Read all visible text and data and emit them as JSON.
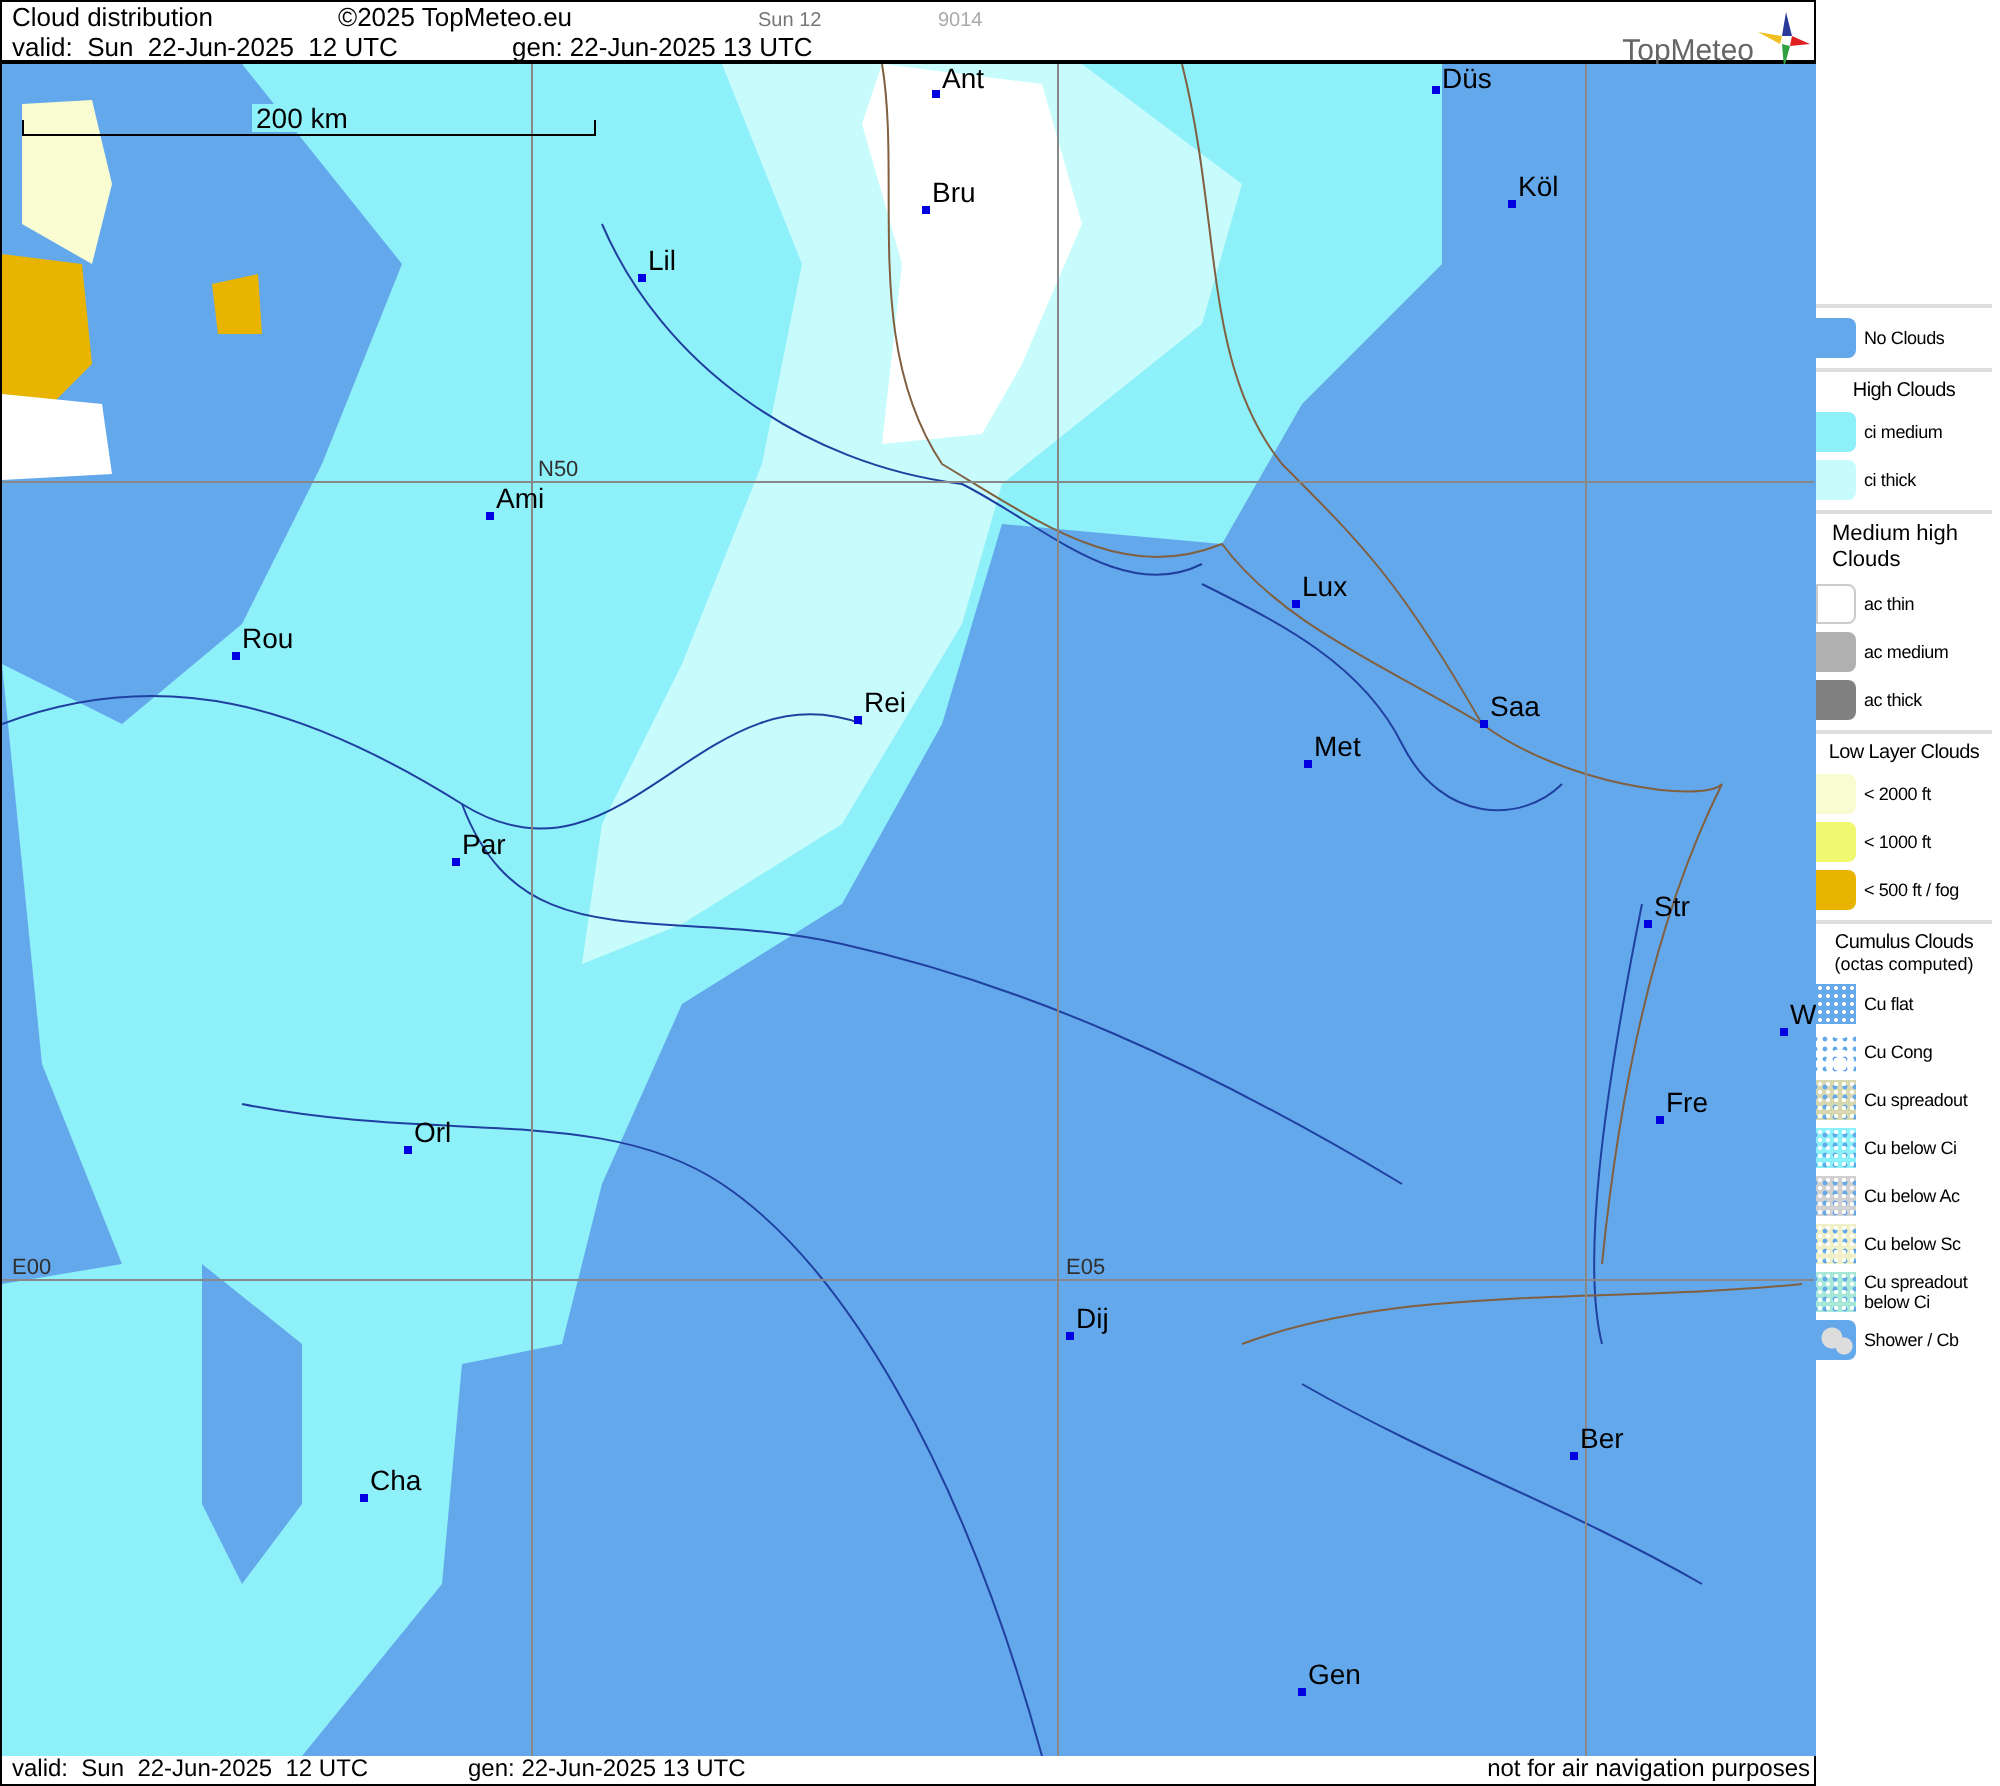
{
  "header": {
    "title": "Cloud distribution",
    "copyright": "©2025 TopMeteo.eu",
    "run": "Sun 12",
    "code": "9014",
    "valid": "valid:  Sun  22-Jun-2025  12 UTC",
    "generated": "gen: 22-Jun-2025 13 UTC",
    "logo": "TopMeteo"
  },
  "map": {
    "scale": "200 km",
    "grid_labels": [
      "N50",
      "E00",
      "E05"
    ],
    "cities": [
      {
        "name": "Ant"
      },
      {
        "name": "Düs"
      },
      {
        "name": "Bru"
      },
      {
        "name": "Köl"
      },
      {
        "name": "Lil"
      },
      {
        "name": "Ami"
      },
      {
        "name": "Lux"
      },
      {
        "name": "Rou"
      },
      {
        "name": "Rei"
      },
      {
        "name": "Saa"
      },
      {
        "name": "Met"
      },
      {
        "name": "Par"
      },
      {
        "name": "Str"
      },
      {
        "name": "W"
      },
      {
        "name": "Fre"
      },
      {
        "name": "Orl"
      },
      {
        "name": "Dij"
      },
      {
        "name": "Ber"
      },
      {
        "name": "Cha"
      },
      {
        "name": "Gen"
      }
    ]
  },
  "legend": {
    "sections": [
      {
        "items": [
          {
            "label": "No Clouds",
            "kind": "solid",
            "color": "#64a8ec"
          }
        ]
      },
      {
        "title": "High Clouds",
        "items": [
          {
            "label": "ci medium",
            "kind": "solid",
            "color": "#8ef0f8"
          },
          {
            "label": "ci thick",
            "kind": "solid",
            "color": "#c8fcfc"
          }
        ]
      },
      {
        "title": "Medium high Clouds",
        "items": [
          {
            "label": "ac thin",
            "kind": "solid",
            "color": "#ffffff"
          },
          {
            "label": "ac medium",
            "kind": "solid",
            "color": "#b0b0b0"
          },
          {
            "label": "ac thick",
            "kind": "solid",
            "color": "#808080"
          }
        ]
      },
      {
        "title": "Low Layer Clouds",
        "items": [
          {
            "label": "< 2000 ft",
            "kind": "solid",
            "color": "#f8fcd0"
          },
          {
            "label": "< 1000 ft",
            "kind": "solid",
            "color": "#f0f870"
          },
          {
            "label": "< 500 ft / fog",
            "kind": "solid",
            "color": "#e8b400"
          }
        ]
      },
      {
        "title": "Cumulus Clouds",
        "subtitle": "(octas computed)",
        "items": [
          {
            "label": "Cu flat",
            "kind": "speckled",
            "color": "#64a8ec"
          },
          {
            "label": "Cu Cong",
            "kind": "speckled",
            "color": "#ffffff"
          },
          {
            "label": "Cu spreadout",
            "kind": "speckled",
            "color": "#d8d8b0"
          },
          {
            "label": "Cu below Ci",
            "kind": "speckled",
            "color": "#8ef0f8"
          },
          {
            "label": "Cu below Ac",
            "kind": "speckled",
            "color": "#d0d0d0"
          },
          {
            "label": "Cu below Sc",
            "kind": "speckled",
            "color": "#f0f0c8"
          },
          {
            "label": "Cu spreadout below Ci",
            "kind": "speckled",
            "color": "#a8e8d8"
          },
          {
            "label": "Shower / Cb",
            "kind": "shower",
            "color": "#64a8ec"
          }
        ]
      }
    ]
  },
  "footer": {
    "valid": "valid:  Sun  22-Jun-2025  12 UTC",
    "generated": "gen: 22-Jun-2025 13 UTC",
    "notice": "not for air navigation purposes"
  }
}
